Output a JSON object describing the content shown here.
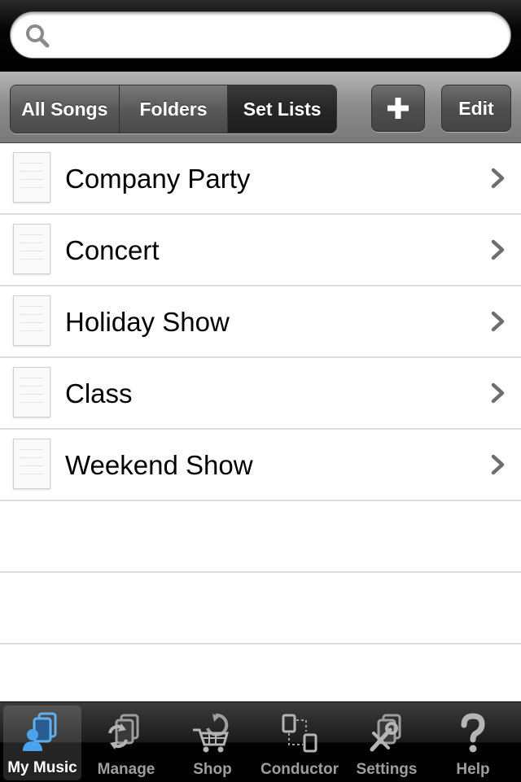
{
  "search": {
    "placeholder": "",
    "value": ""
  },
  "toolbar": {
    "segments": [
      {
        "label": "All Songs"
      },
      {
        "label": "Folders"
      },
      {
        "label": "Set Lists"
      }
    ],
    "selected_segment": "Set Lists",
    "add_label": "+",
    "edit_label": "Edit"
  },
  "set_lists": [
    {
      "label": "Company Party"
    },
    {
      "label": "Concert"
    },
    {
      "label": "Holiday Show"
    },
    {
      "label": "Class"
    },
    {
      "label": "Weekend Show"
    }
  ],
  "tabs": [
    {
      "label": "My Music",
      "icon": "my-music-icon"
    },
    {
      "label": "Manage",
      "icon": "manage-icon"
    },
    {
      "label": "Shop",
      "icon": "shop-cart-icon"
    },
    {
      "label": "Conductor",
      "icon": "conductor-devices-icon"
    },
    {
      "label": "Settings",
      "icon": "settings-tools-icon"
    },
    {
      "label": "Help",
      "icon": "help-question-icon"
    }
  ],
  "selected_tab": "My Music",
  "colors": {
    "accent": "#3b8fe0",
    "tab_inactive": "#9e9e9e"
  }
}
